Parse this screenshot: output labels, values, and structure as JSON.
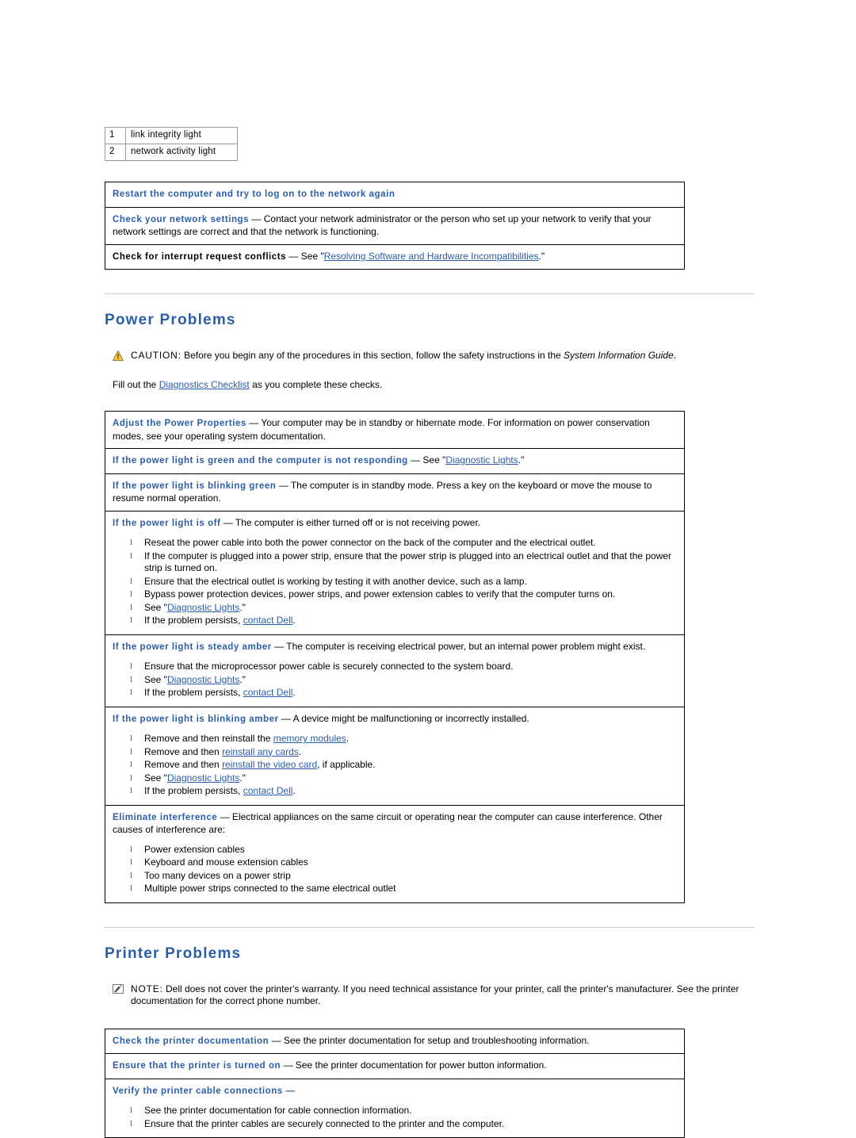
{
  "legend": {
    "rows": [
      {
        "num": "1",
        "label": "link integrity light"
      },
      {
        "num": "2",
        "label": "network activity light"
      }
    ]
  },
  "network_box": {
    "rows": [
      {
        "term": "Restart the computer and try to log on to the network again",
        "term_color": "#2b5ea8",
        "body": ""
      },
      {
        "term": "Check your network settings",
        "term_color": "#2b5ea8",
        "body": " — Contact your network administrator or the person who set up your network to verify that your network settings are correct and that the network is functioning."
      },
      {
        "term": "Check for interrupt request conflicts",
        "term_color": "#000000",
        "body_pre": " — See \"",
        "link": "Resolving Software and Hardware Incompatibilities",
        "body_post": ".\""
      }
    ]
  },
  "power": {
    "heading": "Power Problems",
    "caution_label": "CAUTION:",
    "caution_text": " Before you begin any of the procedures in this section, follow the safety instructions in the ",
    "caution_italic": "System Information Guide",
    "caution_end": ".",
    "fillout_pre": "Fill out the ",
    "fillout_link": "Diagnostics Checklist",
    "fillout_post": " as you complete these checks.",
    "rows": [
      {
        "term": "Adjust the Power Properties",
        "body": " — Your computer may be in standby or hibernate mode. For information on power conservation modes, see your operating system documentation."
      },
      {
        "term": "If the power light is green and the computer is not responding",
        "body_pre": " — See \"",
        "link": "Diagnostic Lights",
        "body_post": ".\""
      },
      {
        "term": "If the power light is blinking green",
        "body": " — The computer is in standby mode. Press a key on the keyboard or move the mouse to resume normal operation."
      },
      {
        "term": "If the power light is off",
        "body": " — The computer is either turned off or is not receiving power.",
        "bullets": [
          {
            "text": "Reseat the power cable into both the power connector on the back of the computer and the electrical outlet."
          },
          {
            "text": "If the computer is plugged into a power strip, ensure that the power strip is plugged into an electrical outlet and that the power strip is turned on."
          },
          {
            "text": "Ensure that the electrical outlet is working by testing it with another device, such as a lamp."
          },
          {
            "text": "Bypass power protection devices, power strips, and power extension cables to verify that the computer turns on."
          },
          {
            "pre": "See \"",
            "link": "Diagnostic Lights",
            "post": ".\""
          },
          {
            "pre": "If the problem persists, ",
            "link": "contact Dell",
            "post": "."
          }
        ]
      },
      {
        "term": "If the power light is steady amber",
        "body": " — The computer is receiving electrical power, but an internal power problem might exist.",
        "bullets": [
          {
            "text": "Ensure that the microprocessor power cable is securely connected to the system board."
          },
          {
            "pre": "See \"",
            "link": "Diagnostic Lights",
            "post": ".\""
          },
          {
            "pre": "If the problem persists, ",
            "link": "contact Dell",
            "post": "."
          }
        ]
      },
      {
        "term": "If the power light is blinking amber",
        "body": " — A device might be malfunctioning or incorrectly installed.",
        "bullets": [
          {
            "pre": "Remove and then reinstall the ",
            "link": "memory modules",
            "post": "."
          },
          {
            "pre": "Remove and then ",
            "link": "reinstall any cards",
            "post": "."
          },
          {
            "pre": "Remove and then ",
            "link": "reinstall the video card",
            "post": ", if applicable."
          },
          {
            "pre": "See \"",
            "link": "Diagnostic Lights",
            "post": ".\""
          },
          {
            "pre": "If the problem persists, ",
            "link": "contact Dell",
            "post": "."
          }
        ]
      },
      {
        "term": "Eliminate interference",
        "body": " — Electrical appliances on the same circuit or operating near the computer can cause interference. Other causes of interference are:",
        "bullets": [
          {
            "text": "Power extension cables"
          },
          {
            "text": "Keyboard and mouse extension cables"
          },
          {
            "text": "Too many devices on a power strip"
          },
          {
            "text": "Multiple power strips connected to the same electrical outlet"
          }
        ]
      }
    ]
  },
  "printer": {
    "heading": "Printer Problems",
    "note_label": "NOTE:",
    "note_text": " Dell does not cover the printer's warranty. If you need technical assistance for your printer, call the printer's manufacturer. See the printer documentation for the correct phone number.",
    "rows": [
      {
        "term": "Check the printer documentation",
        "body": " — See the printer documentation for setup and troubleshooting information."
      },
      {
        "term": "Ensure that the printer is turned on",
        "body": " — See the printer documentation for power button information."
      },
      {
        "term": "Verify the printer cable connections —",
        "body": "",
        "bullets": [
          {
            "text": "See the printer documentation for cable connection information."
          },
          {
            "text": "Ensure that the printer cables are securely connected to the printer and the computer."
          }
        ]
      }
    ]
  }
}
